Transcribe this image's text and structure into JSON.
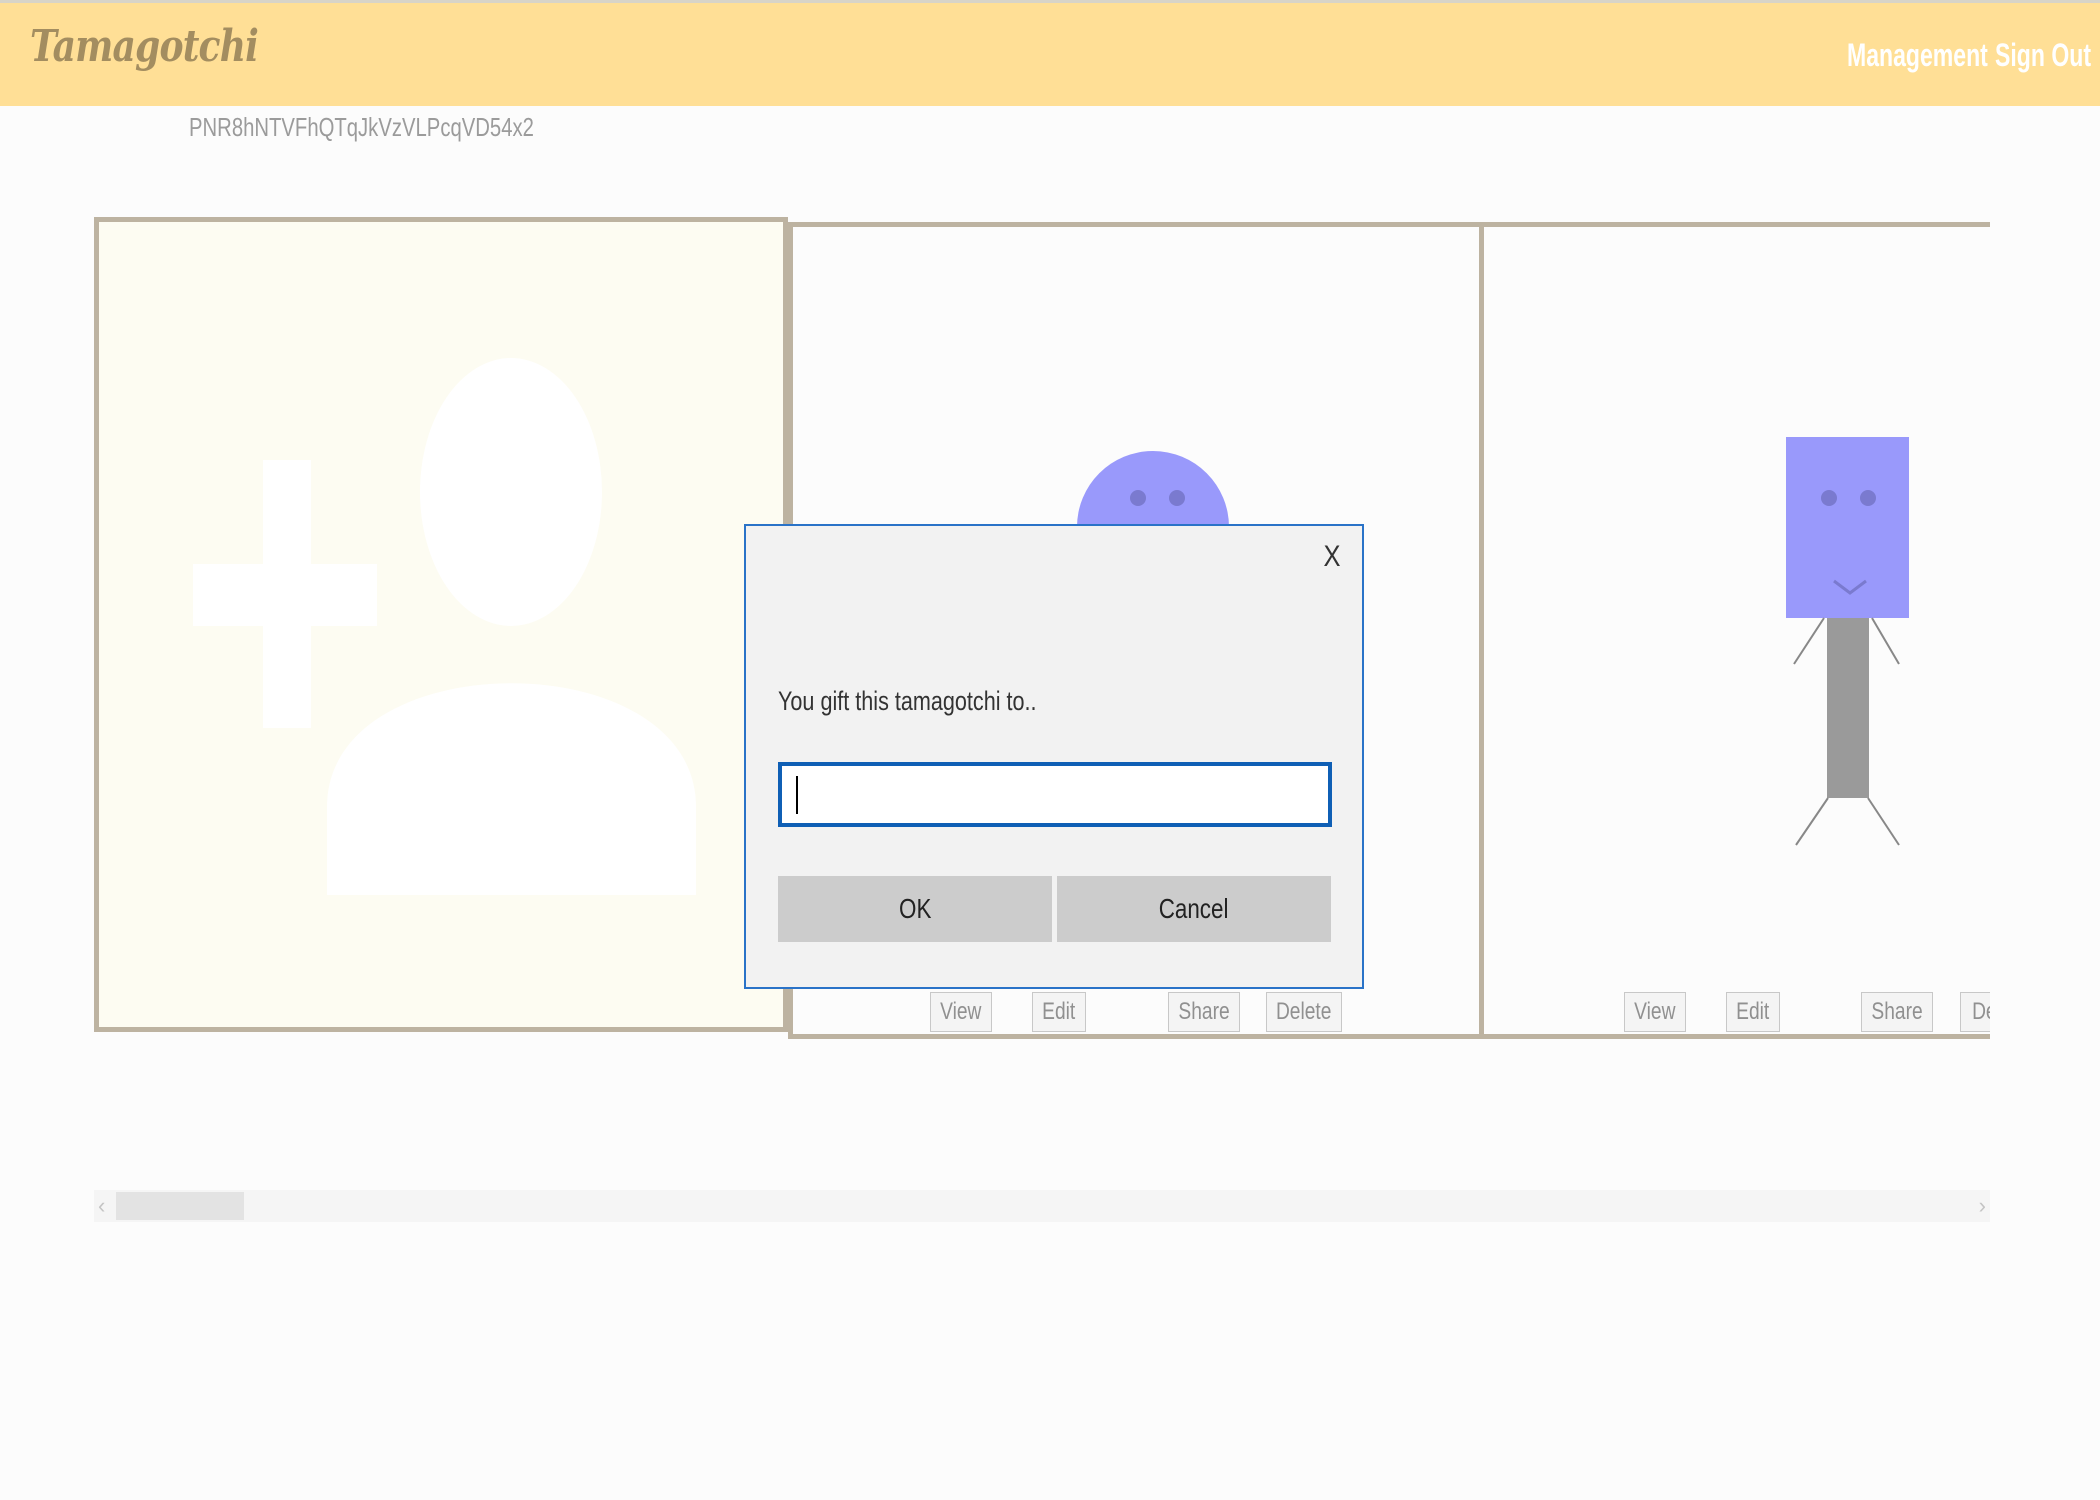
{
  "header": {
    "logo": "Tamagotchi",
    "nav": {
      "management": "Management",
      "sign_out": "Sign Out"
    }
  },
  "user": {
    "code": "PNR8hNTVFhQTqJkVzVLPcqVD54x2"
  },
  "cards": [
    {
      "type": "add-new",
      "icon": "add-person-icon"
    },
    {
      "type": "tamagotchi",
      "character": "round-head",
      "color": "#9999fb",
      "actions": [
        "View",
        "Edit",
        "Share",
        "Delete"
      ]
    },
    {
      "type": "tamagotchi",
      "character": "square-head",
      "color": "#9999fb",
      "actions": [
        "View",
        "Edit",
        "Share",
        "De"
      ]
    }
  ],
  "dialog": {
    "close_label": "X",
    "message": "You gift this tamagotchi to..",
    "input_value": "",
    "ok_label": "OK",
    "cancel_label": "Cancel"
  },
  "scrollbar": {
    "left_arrow": "‹",
    "right_arrow": "›"
  },
  "colors": {
    "header_bg": "#ffdf96",
    "card_border": "#bdb3a1",
    "character": "#9999fb",
    "dialog_border": "#2a73c8"
  }
}
